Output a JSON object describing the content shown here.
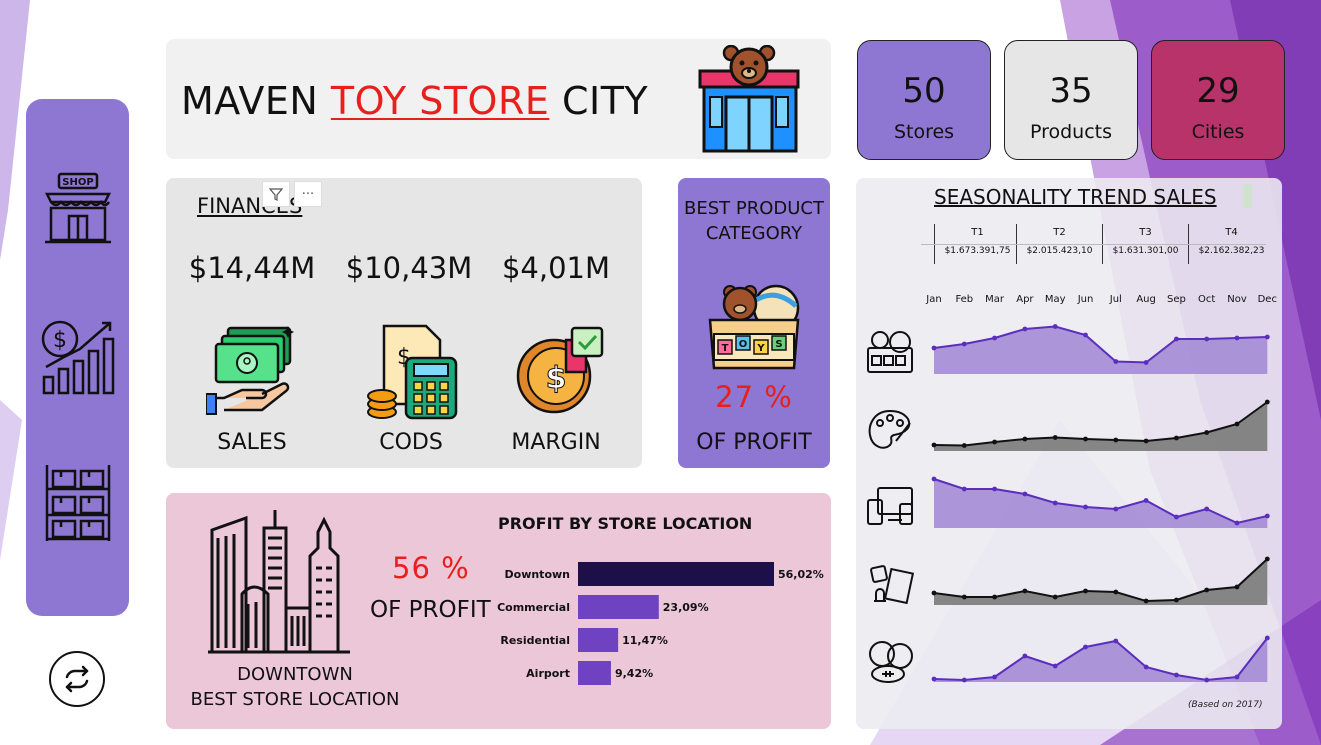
{
  "title": {
    "part1": "MAVEN ",
    "highlight": "TOY STORE",
    "part2": " CITY"
  },
  "kpis": [
    {
      "value": "50",
      "label": "Stores",
      "color": "#8e76d3"
    },
    {
      "value": "35",
      "label": "Products",
      "color": "#e6e6e6"
    },
    {
      "value": "29",
      "label": "Cities",
      "color": "#b8336a"
    }
  ],
  "finances": {
    "title": "FINANCES",
    "items": [
      {
        "value": "$14,44M",
        "label": "SALES",
        "icon": "money-hand-icon"
      },
      {
        "value": "$10,43M",
        "label": "CODS",
        "icon": "calculator-icon"
      },
      {
        "value": "$4,01M",
        "label": "MARGIN",
        "icon": "margin-coin-icon"
      }
    ]
  },
  "best_product": {
    "title": "BEST PRODUCT CATEGORY",
    "percent": "27 %",
    "of_profit": "OF PROFIT",
    "icon": "toy-box-icon"
  },
  "downtown": {
    "percent": "56 %",
    "of_profit": "OF PROFIT",
    "label_line1": "DOWNTOWN",
    "label_line2": "BEST STORE LOCATION",
    "icon": "city-skyline-icon"
  },
  "chart_data": [
    {
      "type": "bar",
      "title": "PROFIT BY STORE LOCATION",
      "categories": [
        "Downtown",
        "Commercial",
        "Residential",
        "Airport"
      ],
      "values": [
        56.02,
        23.09,
        11.47,
        9.42
      ],
      "labels": [
        "56,02%",
        "23,09%",
        "11,47%",
        "9,42%"
      ],
      "colors": [
        "#1c0f4a",
        "#6e42c1",
        "#6e42c1",
        "#6e42c1"
      ],
      "orientation": "horizontal"
    },
    {
      "type": "area",
      "title": "SEASONALITY TREND SALES",
      "categories": [
        "Jan",
        "Feb",
        "Mar",
        "Apr",
        "May",
        "Jun",
        "Jul",
        "Aug",
        "Sep",
        "Oct",
        "Nov",
        "Dec"
      ],
      "quarters": [
        {
          "label": "T1",
          "value": "$1.673.391,75"
        },
        {
          "label": "T2",
          "value": "$2.015.423,10"
        },
        {
          "label": "T3",
          "value": "$1.631.301,00"
        },
        {
          "label": "T4",
          "value": "$2.162.382,23"
        }
      ],
      "series": [
        {
          "icon": "toys-icon",
          "color": "#5b2ebd",
          "fill": "#a58bd6",
          "values": [
            0.52,
            0.6,
            0.72,
            0.9,
            0.95,
            0.78,
            0.25,
            0.23,
            0.7,
            0.7,
            0.72,
            0.74
          ]
        },
        {
          "icon": "art-palette-icon",
          "color": "#111111",
          "fill": "#7a7a7a",
          "values": [
            0.12,
            0.11,
            0.18,
            0.24,
            0.27,
            0.24,
            0.22,
            0.2,
            0.26,
            0.37,
            0.54,
            0.98
          ]
        },
        {
          "icon": "electronics-icon",
          "color": "#5b2ebd",
          "fill": "#a58bd6",
          "values": [
            0.98,
            0.78,
            0.78,
            0.68,
            0.5,
            0.42,
            0.38,
            0.55,
            0.22,
            0.38,
            0.1,
            0.24
          ]
        },
        {
          "icon": "games-icon",
          "color": "#111111",
          "fill": "#7a7a7a",
          "values": [
            0.24,
            0.16,
            0.16,
            0.28,
            0.16,
            0.28,
            0.26,
            0.08,
            0.1,
            0.3,
            0.36,
            0.92
          ]
        },
        {
          "icon": "sports-balls-icon",
          "color": "#5b2ebd",
          "fill": "#a58bd6",
          "values": [
            0.06,
            0.04,
            0.1,
            0.52,
            0.32,
            0.7,
            0.82,
            0.3,
            0.14,
            0.04,
            0.1,
            0.88
          ]
        }
      ],
      "note": "(Based on 2017)"
    }
  ]
}
